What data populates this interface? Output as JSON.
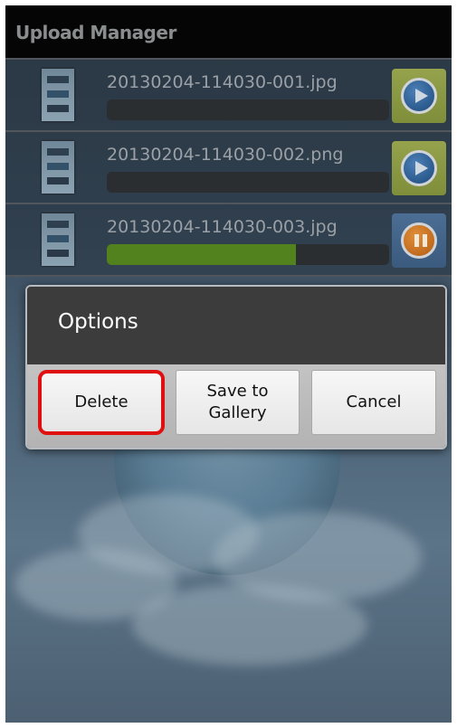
{
  "app": {
    "title": "Upload Manager"
  },
  "uploads": [
    {
      "filename": "20130204-114030-001.jpg",
      "progress": 0.0,
      "action": "play-icon"
    },
    {
      "filename": "20130204-114030-002.png",
      "progress": 0.0,
      "action": "play-icon"
    },
    {
      "filename": "20130204-114030-003.jpg",
      "progress": 0.67,
      "action": "pause-icon"
    }
  ],
  "dialog": {
    "title": "Options",
    "buttons": {
      "delete": "Delete",
      "save": "Save to\nGallery",
      "cancel": "Cancel"
    },
    "highlight_color": "#e01010"
  },
  "colors": {
    "progress_fill": "#51821e",
    "play_button_bg": "#8f9a44",
    "pause_button_bg": "#44668c"
  }
}
